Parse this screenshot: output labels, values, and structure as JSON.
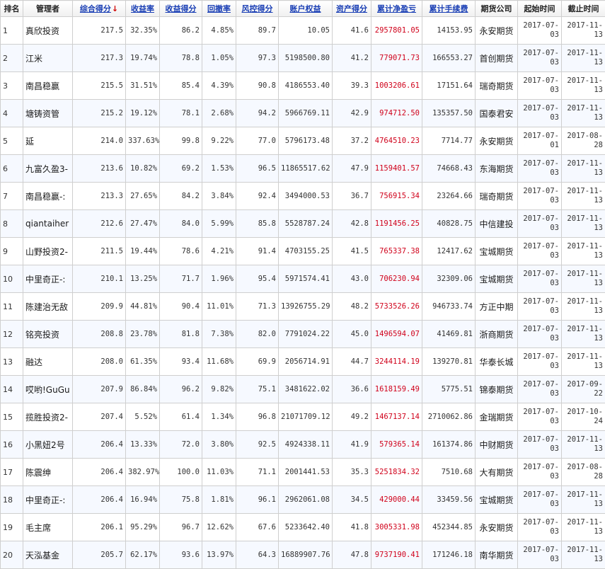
{
  "columns": [
    "排名",
    "管理者",
    "综合得分",
    "收益率",
    "收益得分",
    "回撤率",
    "风控得分",
    "账户权益",
    "资产得分",
    "累计净盈亏",
    "累计手续费",
    "期货公司",
    "起始时间",
    "截止时间"
  ],
  "sort_arrow": "↓",
  "rows": [
    {
      "rank": "1",
      "manager": "真欣投资",
      "score": "217.5",
      "return_rate": "32.35%",
      "return_score": "86.2",
      "drawdown": "4.85%",
      "risk_score": "89.7",
      "equity": "10.05",
      "asset_score": "41.6",
      "net_pnl": "2957801.05",
      "fees": "14153.95",
      "company": "永安期货",
      "start": "2017-07-03",
      "end": "2017-11-13"
    },
    {
      "rank": "2",
      "manager": "江米",
      "score": "217.3",
      "return_rate": "19.74%",
      "return_score": "78.8",
      "drawdown": "1.05%",
      "risk_score": "97.3",
      "equity": "5198500.80",
      "asset_score": "41.2",
      "net_pnl": "779071.73",
      "fees": "166553.27",
      "company": "首创期货",
      "start": "2017-07-03",
      "end": "2017-11-13"
    },
    {
      "rank": "3",
      "manager": "南昌稳赢",
      "score": "215.5",
      "return_rate": "31.51%",
      "return_score": "85.4",
      "drawdown": "4.39%",
      "risk_score": "90.8",
      "equity": "4186553.40",
      "asset_score": "39.3",
      "net_pnl": "1003206.61",
      "fees": "17151.64",
      "company": "瑞奇期货",
      "start": "2017-07-03",
      "end": "2017-11-13"
    },
    {
      "rank": "4",
      "manager": "塘铸资管",
      "score": "215.2",
      "return_rate": "19.12%",
      "return_score": "78.1",
      "drawdown": "2.68%",
      "risk_score": "94.2",
      "equity": "5966769.11",
      "asset_score": "42.9",
      "net_pnl": "974712.50",
      "fees": "135357.50",
      "company": "国泰君安",
      "start": "2017-07-03",
      "end": "2017-11-13"
    },
    {
      "rank": "5",
      "manager": "延",
      "score": "214.0",
      "return_rate": "337.63%",
      "return_score": "99.8",
      "drawdown": "9.22%",
      "risk_score": "77.0",
      "equity": "5796173.48",
      "asset_score": "37.2",
      "net_pnl": "4764510.23",
      "fees": "7714.77",
      "company": "永安期货",
      "start": "2017-07-01",
      "end": "2017-08-28"
    },
    {
      "rank": "6",
      "manager": "九富久盈3-",
      "score": "213.6",
      "return_rate": "10.82%",
      "return_score": "69.2",
      "drawdown": "1.53%",
      "risk_score": "96.5",
      "equity": "11865517.62",
      "asset_score": "47.9",
      "net_pnl": "1159401.57",
      "fees": "74668.43",
      "company": "东海期货",
      "start": "2017-07-03",
      "end": "2017-11-13"
    },
    {
      "rank": "7",
      "manager": "南昌稳赢-:",
      "score": "213.3",
      "return_rate": "27.65%",
      "return_score": "84.2",
      "drawdown": "3.84%",
      "risk_score": "92.4",
      "equity": "3494000.53",
      "asset_score": "36.7",
      "net_pnl": "756915.34",
      "fees": "23264.66",
      "company": "瑞奇期货",
      "start": "2017-07-03",
      "end": "2017-11-13"
    },
    {
      "rank": "8",
      "manager": "qiantaiher",
      "score": "212.6",
      "return_rate": "27.47%",
      "return_score": "84.0",
      "drawdown": "5.99%",
      "risk_score": "85.8",
      "equity": "5528787.24",
      "asset_score": "42.8",
      "net_pnl": "1191456.25",
      "fees": "40828.75",
      "company": "中信建投",
      "start": "2017-07-03",
      "end": "2017-11-13"
    },
    {
      "rank": "9",
      "manager": "山野投资2-",
      "score": "211.5",
      "return_rate": "19.44%",
      "return_score": "78.6",
      "drawdown": "4.21%",
      "risk_score": "91.4",
      "equity": "4703155.25",
      "asset_score": "41.5",
      "net_pnl": "765337.38",
      "fees": "12417.62",
      "company": "宝城期货",
      "start": "2017-07-03",
      "end": "2017-11-13"
    },
    {
      "rank": "10",
      "manager": "中里奇正-:",
      "score": "210.1",
      "return_rate": "13.25%",
      "return_score": "71.7",
      "drawdown": "1.96%",
      "risk_score": "95.4",
      "equity": "5971574.41",
      "asset_score": "43.0",
      "net_pnl": "706230.94",
      "fees": "32309.06",
      "company": "宝城期货",
      "start": "2017-07-03",
      "end": "2017-11-13"
    },
    {
      "rank": "11",
      "manager": "陈建治无敌",
      "score": "209.9",
      "return_rate": "44.81%",
      "return_score": "90.4",
      "drawdown": "11.01%",
      "risk_score": "71.3",
      "equity": "13926755.29",
      "asset_score": "48.2",
      "net_pnl": "5733526.26",
      "fees": "946733.74",
      "company": "方正中期",
      "start": "2017-07-03",
      "end": "2017-11-13"
    },
    {
      "rank": "12",
      "manager": "铭亮投资",
      "score": "208.8",
      "return_rate": "23.78%",
      "return_score": "81.8",
      "drawdown": "7.38%",
      "risk_score": "82.0",
      "equity": "7791024.22",
      "asset_score": "45.0",
      "net_pnl": "1496594.07",
      "fees": "41469.81",
      "company": "浙商期货",
      "start": "2017-07-03",
      "end": "2017-11-13"
    },
    {
      "rank": "13",
      "manager": "融达",
      "score": "208.0",
      "return_rate": "61.35%",
      "return_score": "93.4",
      "drawdown": "11.68%",
      "risk_score": "69.9",
      "equity": "2056714.91",
      "asset_score": "44.7",
      "net_pnl": "3244114.19",
      "fees": "139270.81",
      "company": "华泰长城",
      "start": "2017-07-03",
      "end": "2017-11-13"
    },
    {
      "rank": "14",
      "manager": "哎哟!GuGu",
      "score": "207.9",
      "return_rate": "86.84%",
      "return_score": "96.2",
      "drawdown": "9.82%",
      "risk_score": "75.1",
      "equity": "3481622.02",
      "asset_score": "36.6",
      "net_pnl": "1618159.49",
      "fees": "5775.51",
      "company": "锦泰期货",
      "start": "2017-07-03",
      "end": "2017-09-22"
    },
    {
      "rank": "15",
      "manager": "揽胜投资2-",
      "score": "207.4",
      "return_rate": "5.52%",
      "return_score": "61.4",
      "drawdown": "1.34%",
      "risk_score": "96.8",
      "equity": "21071709.12",
      "asset_score": "49.2",
      "net_pnl": "1467137.14",
      "fees": "2710062.86",
      "company": "金瑞期货",
      "start": "2017-07-03",
      "end": "2017-10-24"
    },
    {
      "rank": "16",
      "manager": "小黑妞2号",
      "score": "206.4",
      "return_rate": "13.33%",
      "return_score": "72.0",
      "drawdown": "3.80%",
      "risk_score": "92.5",
      "equity": "4924338.11",
      "asset_score": "41.9",
      "net_pnl": "579365.14",
      "fees": "161374.86",
      "company": "中财期货",
      "start": "2017-07-03",
      "end": "2017-11-13"
    },
    {
      "rank": "17",
      "manager": "陈震绅",
      "score": "206.4",
      "return_rate": "382.97%",
      "return_score": "100.0",
      "drawdown": "11.03%",
      "risk_score": "71.1",
      "equity": "2001441.53",
      "asset_score": "35.3",
      "net_pnl": "5251834.32",
      "fees": "7510.68",
      "company": "大有期货",
      "start": "2017-07-03",
      "end": "2017-08-28"
    },
    {
      "rank": "18",
      "manager": "中里奇正-:",
      "score": "206.4",
      "return_rate": "16.94%",
      "return_score": "75.8",
      "drawdown": "1.81%",
      "risk_score": "96.1",
      "equity": "2962061.08",
      "asset_score": "34.5",
      "net_pnl": "429000.44",
      "fees": "33459.56",
      "company": "宝城期货",
      "start": "2017-07-03",
      "end": "2017-11-13"
    },
    {
      "rank": "19",
      "manager": "毛主席",
      "score": "206.1",
      "return_rate": "95.29%",
      "return_score": "96.7",
      "drawdown": "12.62%",
      "risk_score": "67.6",
      "equity": "5233642.40",
      "asset_score": "41.8",
      "net_pnl": "3005331.98",
      "fees": "452344.85",
      "company": "永安期货",
      "start": "2017-07-03",
      "end": "2017-11-13"
    },
    {
      "rank": "20",
      "manager": "天泓基金",
      "score": "205.7",
      "return_rate": "62.17%",
      "return_score": "93.6",
      "drawdown": "13.97%",
      "risk_score": "64.3",
      "equity": "16889907.76",
      "asset_score": "47.8",
      "net_pnl": "9737190.41",
      "fees": "171246.18",
      "company": "南华期货",
      "start": "2017-07-03",
      "end": "2017-11-13"
    }
  ]
}
